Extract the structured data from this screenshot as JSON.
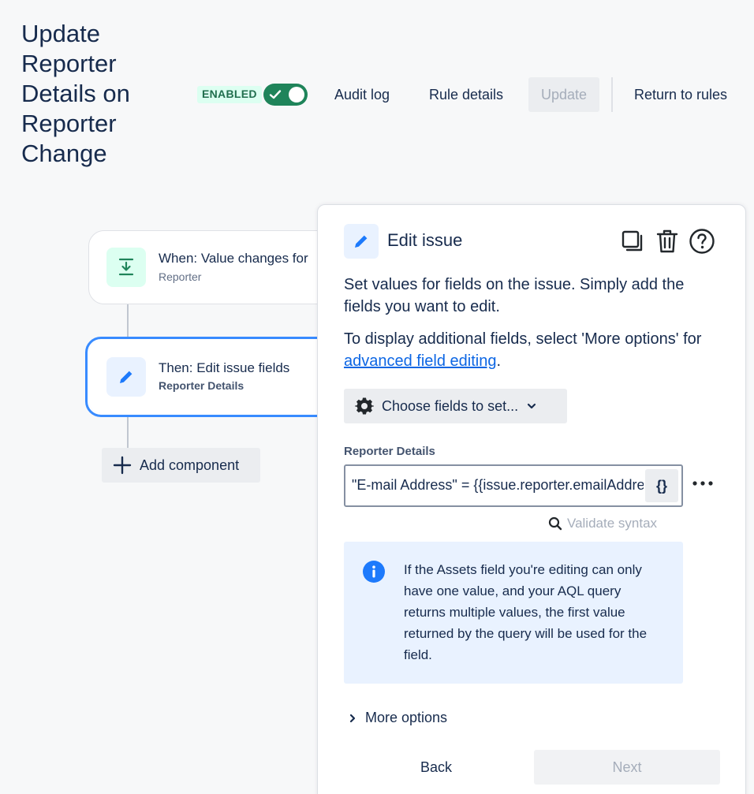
{
  "header": {
    "title": "Update Reporter Details on Reporter Change",
    "status_lozenge": "ENABLED",
    "toggle_on": true,
    "audit_log": "Audit log",
    "rule_details": "Rule details",
    "update": "Update",
    "return_to_rules": "Return to rules"
  },
  "flow": {
    "trigger": {
      "title": "When: Value changes for",
      "subtitle": "Reporter"
    },
    "action": {
      "title": "Then: Edit issue fields",
      "subtitle": "Reporter Details"
    },
    "add_component": "Add component"
  },
  "panel": {
    "title": "Edit issue",
    "description_1": "Set values for fields on the issue. Simply add the fields you want to edit.",
    "description_2_prefix": "To display additional fields, select 'More options' for ",
    "description_2_link": "advanced field editing",
    "description_2_suffix": ".",
    "choose_fields": "Choose fields to set...",
    "field_label": "Reporter Details",
    "field_value": "\"E-mail Address\" = {{issue.reporter.emailAddress}}",
    "smart_values_button": "{}",
    "validate_syntax": "Validate syntax",
    "info_text": "If the Assets field you're editing can only have one value, and your AQL query returns multiple values, the first value returned by the query will be used for the field.",
    "more_options": "More options",
    "back": "Back",
    "next": "Next"
  },
  "colors": {
    "accent": "#0c66e4",
    "enabled_green": "#1f845a",
    "selected_border": "#388bff",
    "trigger_icon_bg": "#dcfff1",
    "info_bg": "#e9f2ff"
  }
}
